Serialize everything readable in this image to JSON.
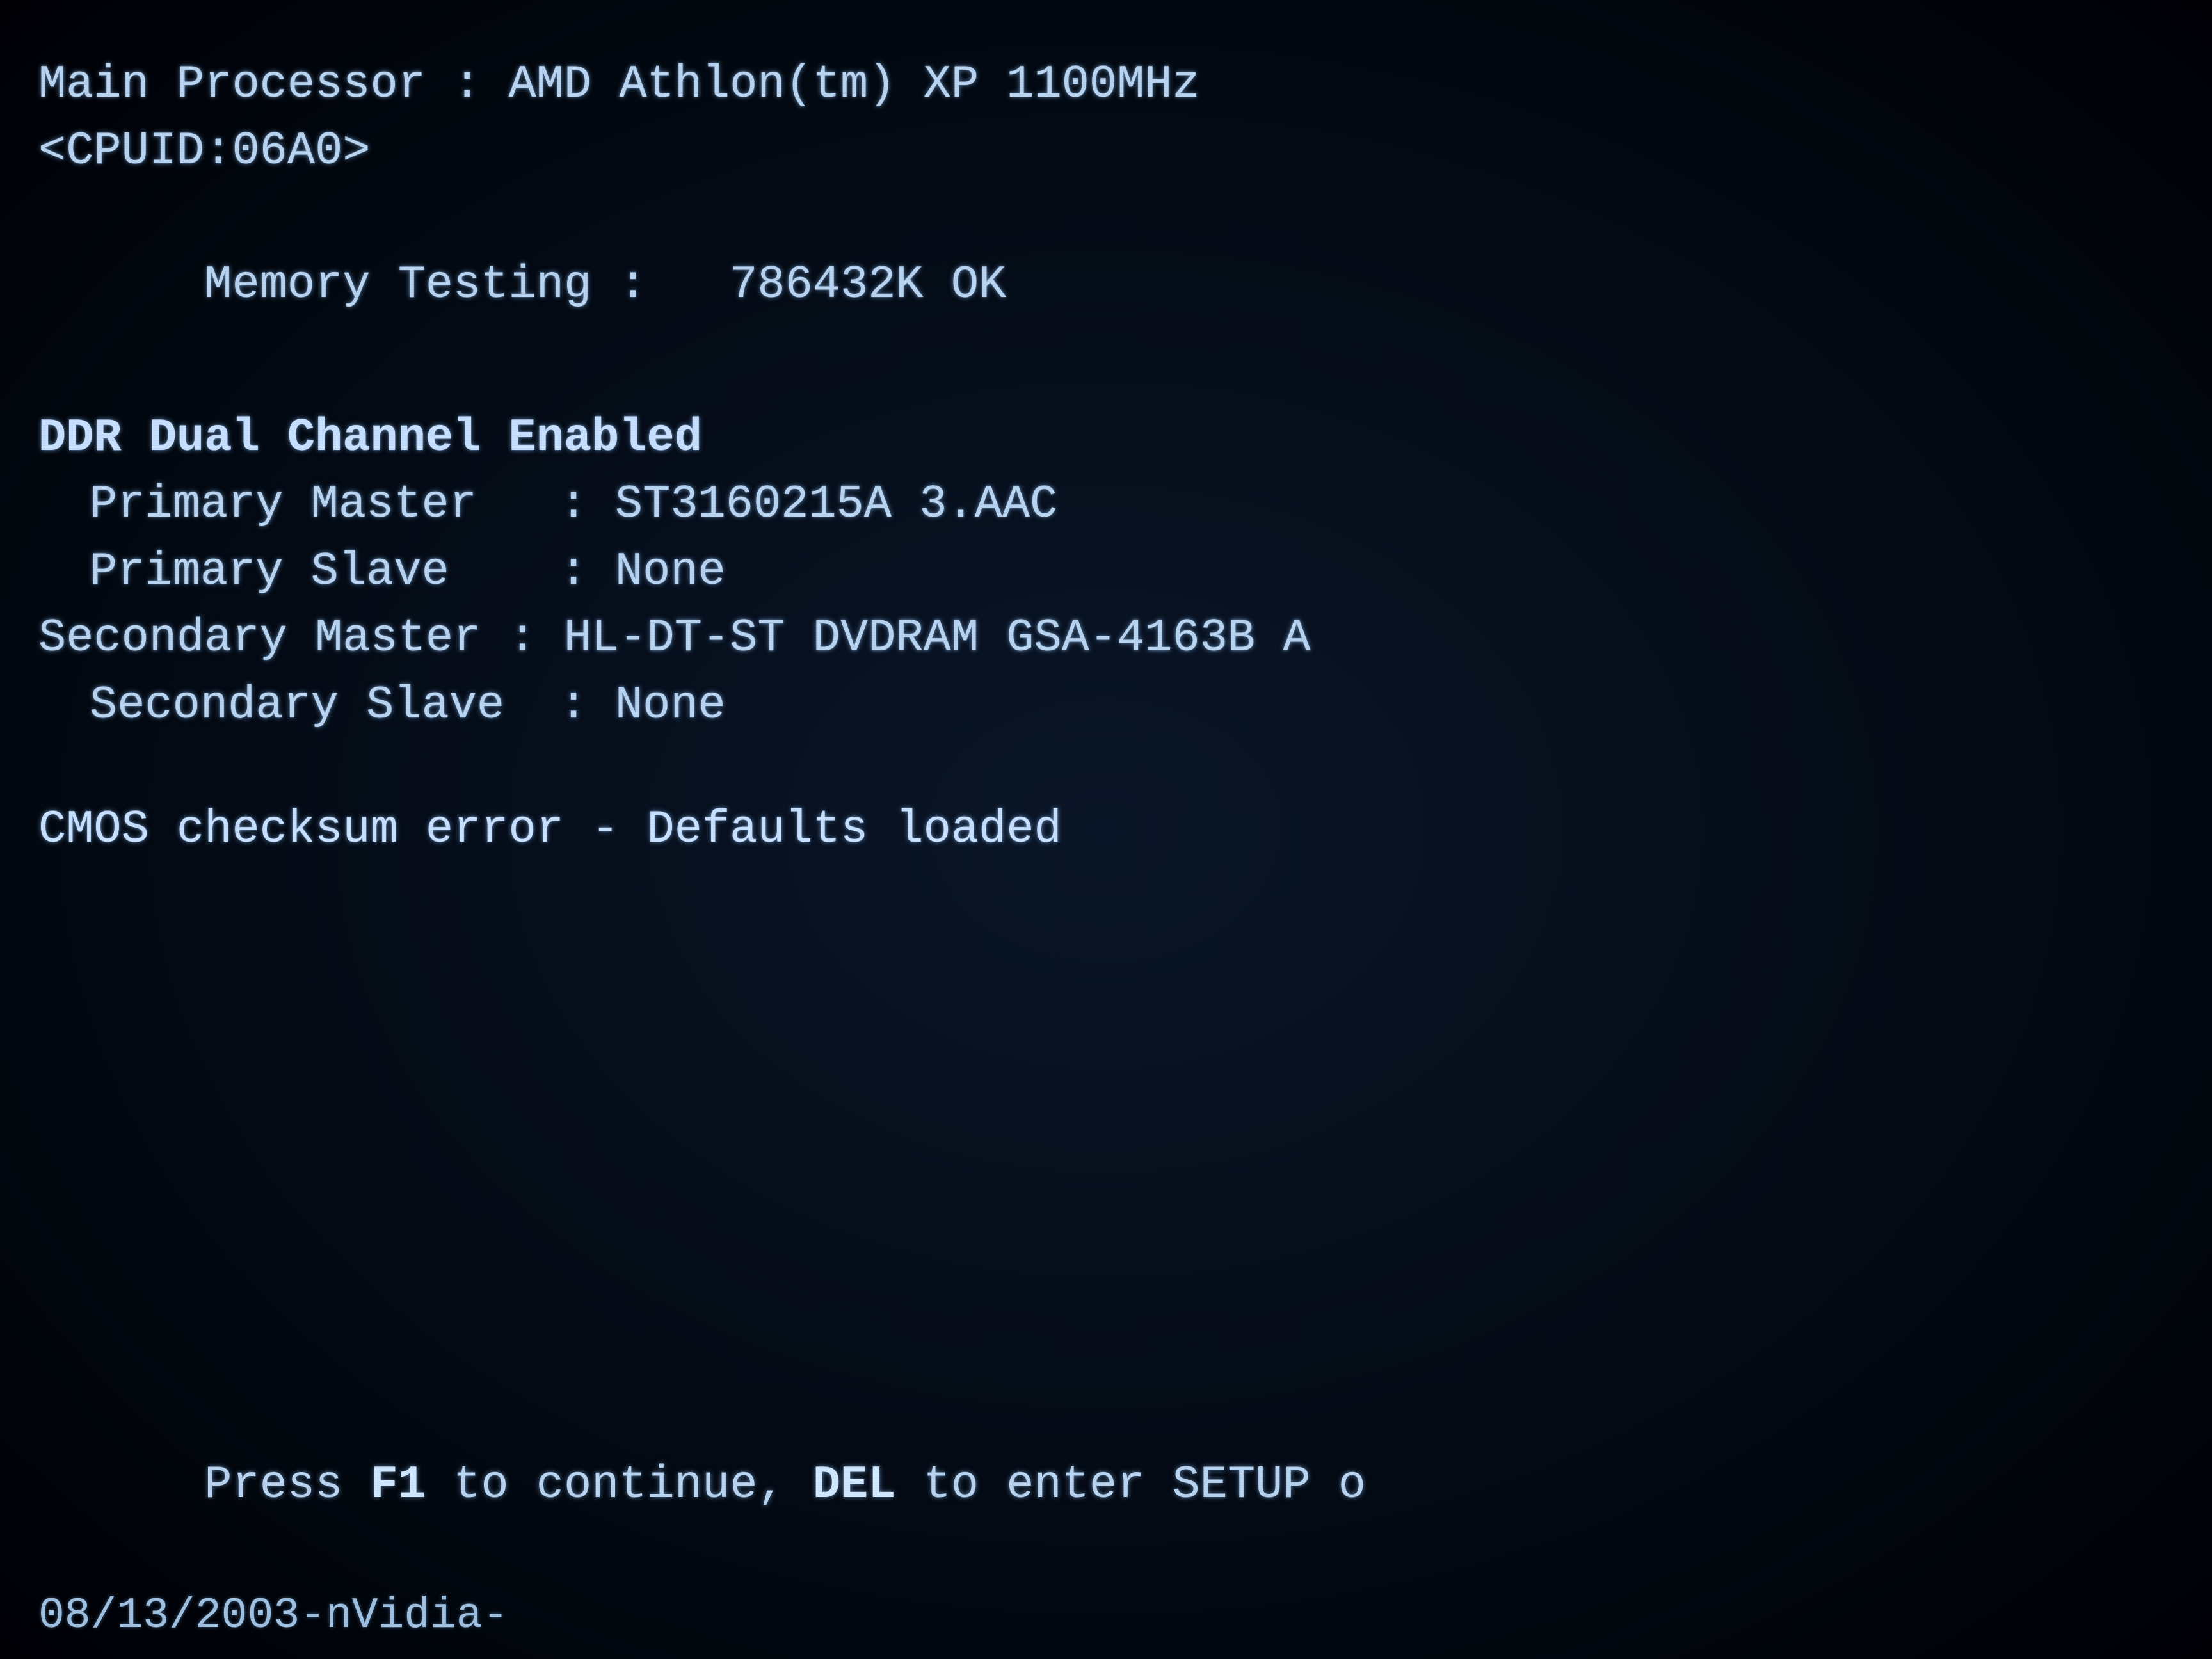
{
  "bios": {
    "main_processor_label": "Main Processor : AMD Athlon(tm) XP 1100MHz",
    "cpuid_line": "<CPUID:06A0>",
    "memory_testing_label": "Memory Testing :",
    "memory_testing_value": "786432K OK",
    "ddr_dual_channel": "DDR Dual Channel Enabled",
    "primary_master_label": "Primary Master   : ST3160215A 3.AAC",
    "primary_slave_label": "Primary Slave    : None",
    "secondary_master_label": "Secondary Master : HL-DT-ST DVDRAM GSA-4163B A",
    "secondary_slave_label": "Secondary Slave  : None",
    "cmos_error": "CMOS checksum error - Defaults loaded",
    "press_f1": "Press ",
    "press_f1_bold": "F1",
    "press_f1_rest": " to continue, ",
    "del_bold": "DEL",
    "del_rest": " to enter SETUP o",
    "date_line": "08/13/2003-nVidia-"
  }
}
